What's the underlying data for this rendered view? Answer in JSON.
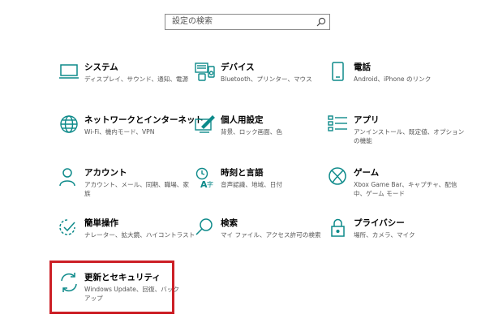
{
  "search": {
    "placeholder": "設定の検索"
  },
  "tiles": [
    {
      "title": "システム",
      "desc": [
        "ディスプレイ、サウンド、通知、電源"
      ]
    },
    {
      "title": "デバイス",
      "desc": [
        "Bluetooth、プリンター、マウス"
      ]
    },
    {
      "title": "電話",
      "desc": [
        "Android、iPhone のリンク"
      ]
    },
    {
      "title": "ネットワークとインターネット",
      "desc": [
        "Wi-Fi、機内モード、VPN"
      ]
    },
    {
      "title": "個人用設定",
      "desc": [
        "背景、ロック画面、色"
      ]
    },
    {
      "title": "アプリ",
      "desc": [
        "アンインストール、既定値、オプション",
        "の機能"
      ]
    },
    {
      "title": "アカウント",
      "desc": [
        "アカウント、メール、同期、職場、家",
        "族"
      ]
    },
    {
      "title": "時刻と言語",
      "desc": [
        "音声認識、地域、日付"
      ]
    },
    {
      "title": "ゲーム",
      "desc": [
        "Xbox Game Bar、キャプチャ、配信",
        "中、ゲーム モード"
      ]
    },
    {
      "title": "簡単操作",
      "desc": [
        "ナレーター、拡大鏡、ハイコントラスト"
      ]
    },
    {
      "title": "検索",
      "desc": [
        "マイ ファイル、アクセス許可の検索"
      ]
    },
    {
      "title": "プライバシー",
      "desc": [
        "場所、カメラ、マイク"
      ]
    },
    {
      "title": "更新とセキュリティ",
      "desc": [
        "Windows Update、回復、バック",
        "アップ"
      ]
    }
  ],
  "colors": {
    "accent": "#0d8a8a",
    "highlight": "#cc1f26"
  },
  "icons": [
    "monitor-icon",
    "devices-icon",
    "phone-icon",
    "globe-icon",
    "personalization-icon",
    "apps-icon",
    "person-icon",
    "time-language-icon",
    "xbox-icon",
    "ease-of-access-icon",
    "search-icon",
    "lock-icon",
    "sync-icon"
  ]
}
